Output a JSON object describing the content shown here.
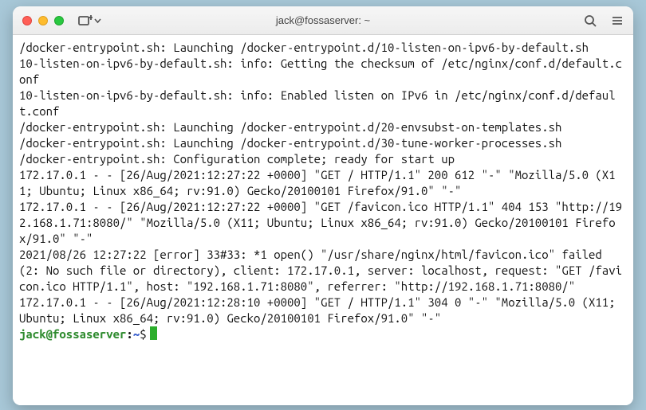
{
  "window": {
    "title": "jack@fossaserver: ~"
  },
  "terminal": {
    "lines": [
      "/docker-entrypoint.sh: Launching /docker-entrypoint.d/10-listen-on-ipv6-by-default.sh",
      "10-listen-on-ipv6-by-default.sh: info: Getting the checksum of /etc/nginx/conf.d/default.conf",
      "10-listen-on-ipv6-by-default.sh: info: Enabled listen on IPv6 in /etc/nginx/conf.d/default.conf",
      "/docker-entrypoint.sh: Launching /docker-entrypoint.d/20-envsubst-on-templates.sh",
      "/docker-entrypoint.sh: Launching /docker-entrypoint.d/30-tune-worker-processes.sh",
      "/docker-entrypoint.sh: Configuration complete; ready for start up",
      "172.17.0.1 - - [26/Aug/2021:12:27:22 +0000] \"GET / HTTP/1.1\" 200 612 \"-\" \"Mozilla/5.0 (X11; Ubuntu; Linux x86_64; rv:91.0) Gecko/20100101 Firefox/91.0\" \"-\"",
      "172.17.0.1 - - [26/Aug/2021:12:27:22 +0000] \"GET /favicon.ico HTTP/1.1\" 404 153 \"http://192.168.1.71:8080/\" \"Mozilla/5.0 (X11; Ubuntu; Linux x86_64; rv:91.0) Gecko/20100101 Firefox/91.0\" \"-\"",
      "2021/08/26 12:27:22 [error] 33#33: *1 open() \"/usr/share/nginx/html/favicon.ico\" failed (2: No such file or directory), client: 172.17.0.1, server: localhost, request: \"GET /favicon.ico HTTP/1.1\", host: \"192.168.1.71:8080\", referrer: \"http://192.168.1.71:8080/\"",
      "172.17.0.1 - - [26/Aug/2021:12:28:10 +0000] \"GET / HTTP/1.1\" 304 0 \"-\" \"Mozilla/5.0 (X11; Ubuntu; Linux x86_64; rv:91.0) Gecko/20100101 Firefox/91.0\" \"-\""
    ],
    "prompt": {
      "user_host": "jack@fossaserver",
      "separator": ":",
      "path": "~",
      "symbol": "$"
    }
  },
  "icons": {
    "new_tab": "new-tab-icon",
    "search": "search-icon",
    "menu": "menu-icon"
  }
}
